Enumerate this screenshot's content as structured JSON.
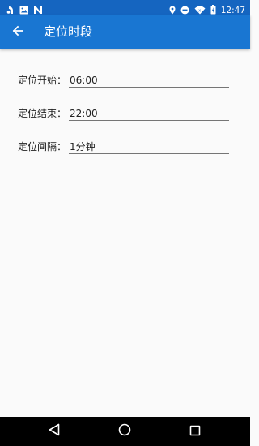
{
  "status_bar": {
    "time": "12:47",
    "left_icons": [
      "notification-icon",
      "image-icon",
      "n-app-icon"
    ],
    "right_icons": [
      "location-icon",
      "do-not-disturb-icon",
      "wifi-icon",
      "battery-icon"
    ]
  },
  "app_bar": {
    "title": "定位时段",
    "back_icon": "arrow-back-icon",
    "background": "#1976d2"
  },
  "form": {
    "fields": [
      {
        "label": "定位开始：",
        "value": "06:00"
      },
      {
        "label": "定位结束：",
        "value": "22:00"
      },
      {
        "label": "定位间隔：",
        "value": "1分钟"
      }
    ]
  },
  "nav_bar": {
    "buttons": [
      "back-triangle-icon",
      "home-circle-icon",
      "recents-square-icon"
    ]
  }
}
